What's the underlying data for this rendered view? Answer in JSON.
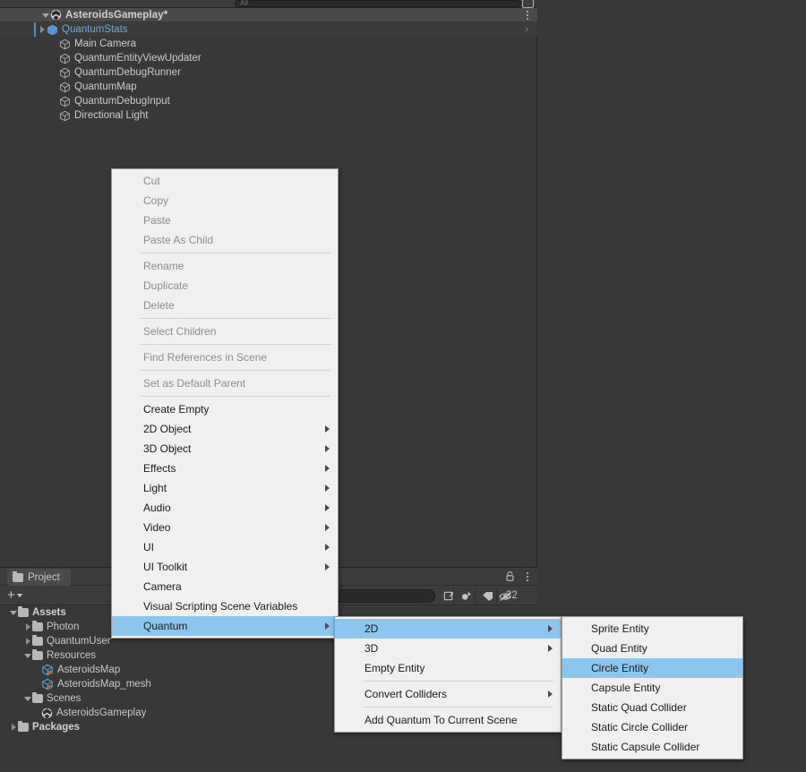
{
  "hierarchy": {
    "search_placeholder": "All",
    "scene": {
      "name": "AsteroidsGameplay*",
      "icon": "unity-scene-icon"
    },
    "items": [
      {
        "label": "QuantumStats",
        "icon": "prefab-cube-icon",
        "type": "prefab",
        "selected": true,
        "expandable": true,
        "indent": 54
      },
      {
        "label": "Main Camera",
        "icon": "gameobject-cube-icon",
        "type": "gameobject",
        "selected": false,
        "expandable": false,
        "indent": 66
      },
      {
        "label": "QuantumEntityViewUpdater",
        "icon": "gameobject-cube-icon",
        "type": "gameobject",
        "selected": false,
        "expandable": false,
        "indent": 66
      },
      {
        "label": "QuantumDebugRunner",
        "icon": "gameobject-cube-icon",
        "type": "gameobject",
        "selected": false,
        "expandable": false,
        "indent": 66
      },
      {
        "label": "QuantumMap",
        "icon": "gameobject-cube-icon",
        "type": "gameobject",
        "selected": false,
        "expandable": false,
        "indent": 66
      },
      {
        "label": "QuantumDebugInput",
        "icon": "gameobject-cube-icon",
        "type": "gameobject",
        "selected": false,
        "expandable": false,
        "indent": 66
      },
      {
        "label": "Directional Light",
        "icon": "gameobject-cube-icon",
        "type": "gameobject",
        "selected": false,
        "expandable": false,
        "indent": 66
      }
    ]
  },
  "project": {
    "tab_label": "Project",
    "toolbar": {
      "add_label": "+",
      "search_value": "",
      "hidden_count": "22",
      "icons": [
        "save-search-icon",
        "favorites-icon",
        "label-icon",
        "hidden-items-icon",
        "lock-icon",
        "kebab-menu-icon"
      ]
    },
    "tree": [
      {
        "label": "Assets",
        "indent": 10,
        "fold": "open",
        "icon": "folder-icon",
        "bold": true
      },
      {
        "label": "Photon",
        "indent": 26,
        "fold": "closed",
        "icon": "folder-icon",
        "bold": false
      },
      {
        "label": "QuantumUser",
        "indent": 26,
        "fold": "closed",
        "icon": "folder-icon",
        "bold": false
      },
      {
        "label": "Resources",
        "indent": 26,
        "fold": "open",
        "icon": "folder-icon",
        "bold": false
      },
      {
        "label": "AsteroidsMap",
        "indent": 44,
        "fold": "none",
        "icon": "quantum-asset-icon",
        "bold": false
      },
      {
        "label": "AsteroidsMap_mesh",
        "indent": 44,
        "fold": "none",
        "icon": "quantum-asset-icon",
        "bold": false
      },
      {
        "label": "Scenes",
        "indent": 26,
        "fold": "open",
        "icon": "folder-icon",
        "bold": false
      },
      {
        "label": "AsteroidsGameplay",
        "indent": 44,
        "fold": "none",
        "icon": "unity-scene-icon",
        "bold": false
      },
      {
        "label": "Packages",
        "indent": 10,
        "fold": "closed",
        "icon": "folder-icon",
        "bold": true
      }
    ]
  },
  "context_menu": {
    "items": [
      {
        "label": "Cut",
        "disabled": true,
        "submenu": false,
        "highlighted": false
      },
      {
        "label": "Copy",
        "disabled": true,
        "submenu": false,
        "highlighted": false
      },
      {
        "label": "Paste",
        "disabled": true,
        "submenu": false,
        "highlighted": false
      },
      {
        "label": "Paste As Child",
        "disabled": true,
        "submenu": false,
        "highlighted": false
      },
      {
        "separator": true
      },
      {
        "label": "Rename",
        "disabled": true,
        "submenu": false,
        "highlighted": false
      },
      {
        "label": "Duplicate",
        "disabled": true,
        "submenu": false,
        "highlighted": false
      },
      {
        "label": "Delete",
        "disabled": true,
        "submenu": false,
        "highlighted": false
      },
      {
        "separator": true
      },
      {
        "label": "Select Children",
        "disabled": true,
        "submenu": false,
        "highlighted": false
      },
      {
        "separator": true
      },
      {
        "label": "Find References in Scene",
        "disabled": true,
        "submenu": false,
        "highlighted": false
      },
      {
        "separator": true
      },
      {
        "label": "Set as Default Parent",
        "disabled": true,
        "submenu": false,
        "highlighted": false
      },
      {
        "separator": true
      },
      {
        "label": "Create Empty",
        "disabled": false,
        "submenu": false,
        "highlighted": false
      },
      {
        "label": "2D Object",
        "disabled": false,
        "submenu": true,
        "highlighted": false
      },
      {
        "label": "3D Object",
        "disabled": false,
        "submenu": true,
        "highlighted": false
      },
      {
        "label": "Effects",
        "disabled": false,
        "submenu": true,
        "highlighted": false
      },
      {
        "label": "Light",
        "disabled": false,
        "submenu": true,
        "highlighted": false
      },
      {
        "label": "Audio",
        "disabled": false,
        "submenu": true,
        "highlighted": false
      },
      {
        "label": "Video",
        "disabled": false,
        "submenu": true,
        "highlighted": false
      },
      {
        "label": "UI",
        "disabled": false,
        "submenu": true,
        "highlighted": false
      },
      {
        "label": "UI Toolkit",
        "disabled": false,
        "submenu": true,
        "highlighted": false
      },
      {
        "label": "Camera",
        "disabled": false,
        "submenu": false,
        "highlighted": false
      },
      {
        "label": "Visual Scripting Scene Variables",
        "disabled": false,
        "submenu": false,
        "highlighted": false
      },
      {
        "label": "Quantum",
        "disabled": false,
        "submenu": true,
        "highlighted": true
      }
    ]
  },
  "quantum_submenu": {
    "items": [
      {
        "label": "2D",
        "disabled": false,
        "submenu": true,
        "highlighted": true
      },
      {
        "label": "3D",
        "disabled": false,
        "submenu": true,
        "highlighted": false
      },
      {
        "label": "Empty Entity",
        "disabled": false,
        "submenu": false,
        "highlighted": false
      },
      {
        "separator": true
      },
      {
        "label": "Convert Colliders",
        "disabled": false,
        "submenu": true,
        "highlighted": false
      },
      {
        "separator": true
      },
      {
        "label": "Add Quantum To Current Scene",
        "disabled": false,
        "submenu": false,
        "highlighted": false
      }
    ]
  },
  "twod_submenu": {
    "items": [
      {
        "label": "Sprite Entity",
        "disabled": false,
        "submenu": false,
        "highlighted": false
      },
      {
        "label": "Quad Entity",
        "disabled": false,
        "submenu": false,
        "highlighted": false
      },
      {
        "label": "Circle Entity",
        "disabled": false,
        "submenu": false,
        "highlighted": true
      },
      {
        "label": "Capsule Entity",
        "disabled": false,
        "submenu": false,
        "highlighted": false
      },
      {
        "label": "Static Quad Collider",
        "disabled": false,
        "submenu": false,
        "highlighted": false
      },
      {
        "label": "Static Circle Collider",
        "disabled": false,
        "submenu": false,
        "highlighted": false
      },
      {
        "label": "Static Capsule Collider",
        "disabled": false,
        "submenu": false,
        "highlighted": false
      }
    ]
  },
  "colors": {
    "menu_background": "#f0f0f0",
    "menu_highlight": "#8cc6ee",
    "editor_background": "#383838",
    "prefab_blue": "#6ca6e8",
    "selection_bar": "#4a90d9"
  }
}
